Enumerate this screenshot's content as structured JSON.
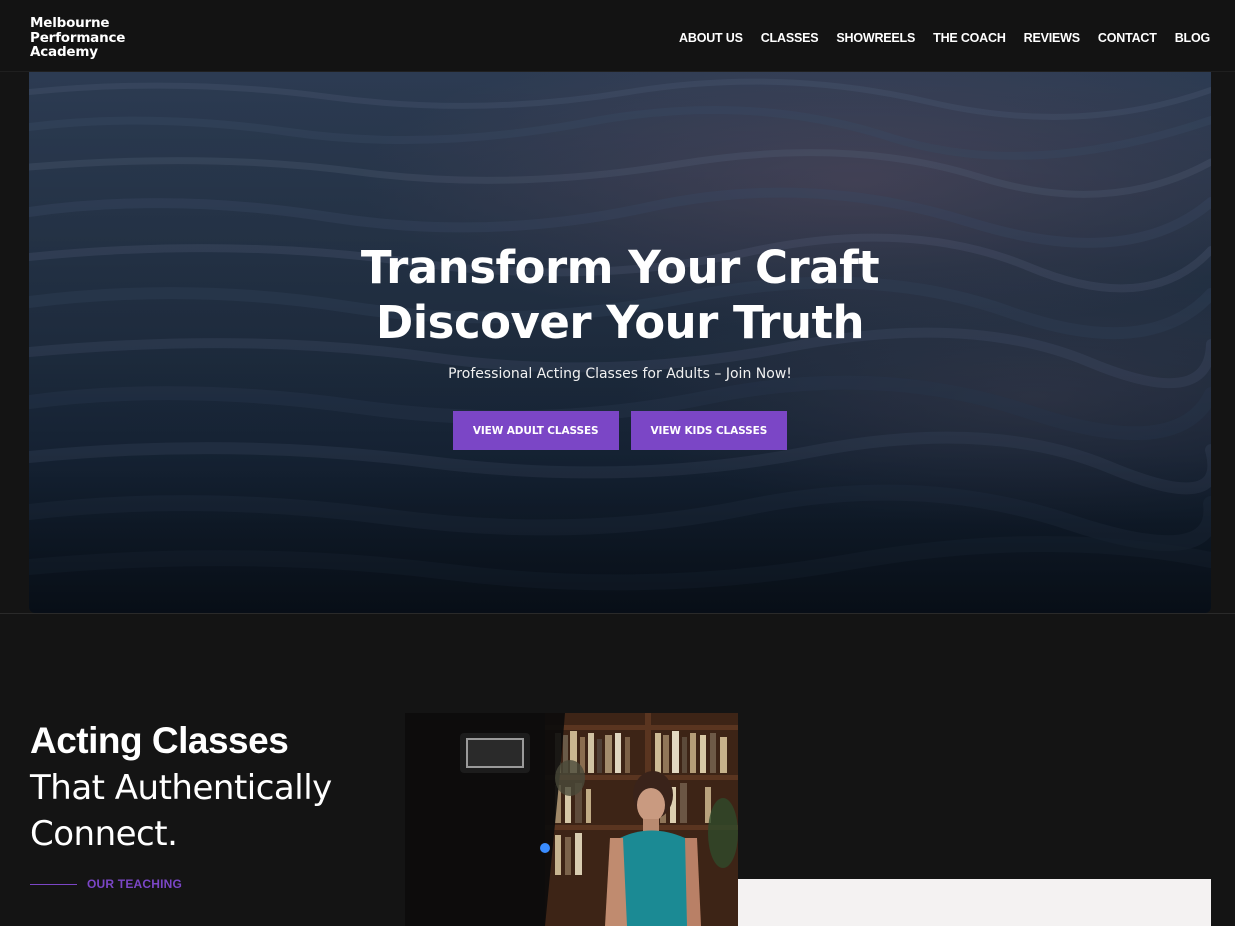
{
  "header": {
    "logo_lines": [
      "Melbourne",
      "Performance",
      "Academy"
    ],
    "nav": [
      "ABOUT US",
      "CLASSES",
      "SHOWREELS",
      "THE COACH",
      "REVIEWS",
      "CONTACT",
      "BLOG"
    ]
  },
  "hero": {
    "title_line1": "Transform Your Craft",
    "title_line2": "Discover Your Truth",
    "subtitle": "Professional Acting Classes for Adults – Join Now!",
    "btn_adult": "VIEW ADULT CLASSES",
    "btn_kids": "VIEW KIDS CLASSES"
  },
  "section": {
    "heading_bold": "Acting Classes",
    "heading_line2": "That Authentically",
    "heading_line3": "Connect.",
    "label": "OUR TEACHING"
  },
  "colors": {
    "accent": "#7b46c6",
    "background": "#141414",
    "card": "#f4f2f2"
  }
}
